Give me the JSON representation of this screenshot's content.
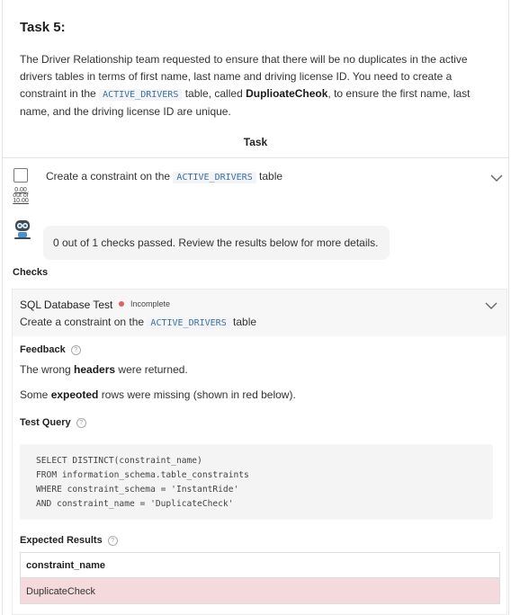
{
  "task": {
    "title": "Task 5:",
    "desc_1": "The Driver Relationship team requested to ensure that there will be no duplicates in the active drivers tables in terms of first name, last name and driving license ID. You need to create a constraint in the ",
    "desc_code": "ACTIVE_DRIVERS",
    "desc_2": " table, called ",
    "desc_bold": "DuplioateCheok",
    "desc_3": ", to ensure the first name, last name, and the driving license ID are unique."
  },
  "task_section": {
    "header": "Task",
    "item_prefix": "Create a constraint on the ",
    "item_code": "ACTIVE_DRIVERS",
    "item_suffix": " table",
    "score_value": "0.00",
    "score_mid": "out of",
    "score_total": "10.00"
  },
  "result_message": "0 out of 1 checks passed. Review the results below for more details.",
  "checks": {
    "label": "Checks",
    "title": "SQL Database Test",
    "status": "Incomplete",
    "status_color": "#e06060",
    "sub_prefix": "Create a constraint on the ",
    "sub_code": "ACTIVE_DRIVERS",
    "sub_suffix": " table",
    "feedback_label": "Feedback",
    "fb1_pre": "The wrong ",
    "fb1_bold": "headers",
    "fb1_post": " were returned.",
    "fb2_pre": "Some ",
    "fb2_bold": "expeoted",
    "fb2_post": " rows were missing (shown in red below).",
    "query_label": "Test Query",
    "query_lines": [
      "SELECT DISTINCT(constraint_name)",
      "FROM information_schema.table_constraints",
      "WHERE constraint_schema = 'InstantRide'",
      "AND constraint_name = 'DuplicateCheck'"
    ],
    "expected_label": "Expected Results",
    "table_header": "constraint_name",
    "table_rows": [
      "DuplicateCheck"
    ]
  }
}
